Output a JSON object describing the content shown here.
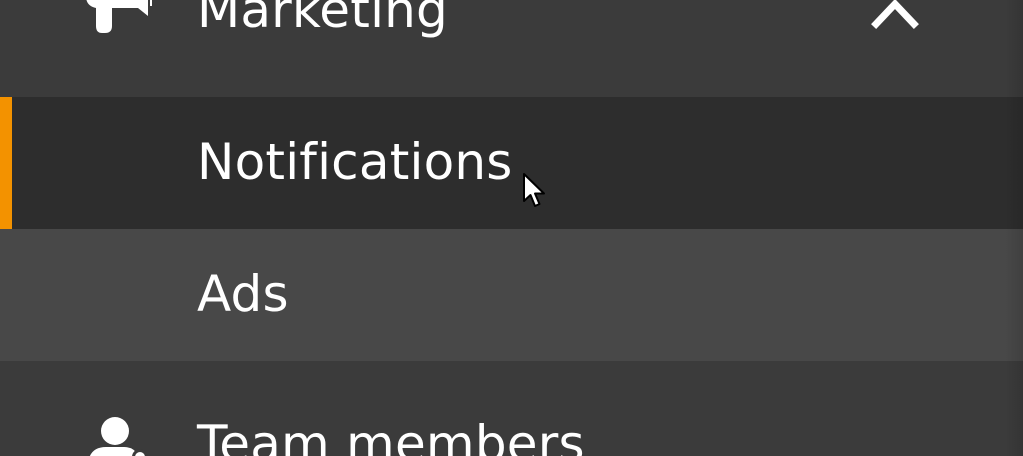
{
  "sidebar": {
    "accent_color": "#f39200",
    "items": [
      {
        "label": "Marketing",
        "icon": "megaphone-icon",
        "expanded": true,
        "expand_icon": "chevron-up-icon"
      },
      {
        "label": "Notifications",
        "active": true
      },
      {
        "label": "Ads",
        "hovered": true
      },
      {
        "label": "Team members",
        "icon": "user-gear-icon"
      }
    ]
  },
  "cursor": "mouse-pointer-icon"
}
